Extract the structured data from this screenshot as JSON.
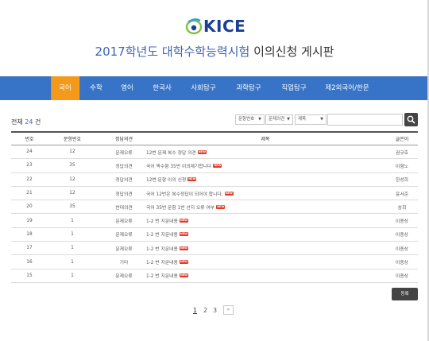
{
  "logo": {
    "text": "KICE"
  },
  "title": {
    "part1": "2017학년도 대학수학능력시험",
    "part2": "이의신청 게시판"
  },
  "nav": {
    "items": [
      {
        "label": "국어",
        "active": true
      },
      {
        "label": "수학",
        "active": false
      },
      {
        "label": "영어",
        "active": false
      },
      {
        "label": "한국사",
        "active": false
      },
      {
        "label": "사회탐구",
        "active": false
      },
      {
        "label": "과학탐구",
        "active": false
      },
      {
        "label": "직업탐구",
        "active": false
      },
      {
        "label": "제2외국어/한문",
        "active": false
      }
    ]
  },
  "count": {
    "prefix": "전체",
    "value": "24",
    "suffix": "건"
  },
  "filters": {
    "type": "문항번호",
    "opinion": "문제의견",
    "field": "제목"
  },
  "table": {
    "headers": {
      "no": "번호",
      "question": "문항번호",
      "opinion": "정답의견",
      "title": "제목",
      "author": "글쓴이"
    },
    "rows": [
      {
        "no": "24",
        "question": "12",
        "opinion": "문제오류",
        "title": "12번 문제 복수 정답 의견",
        "new": "NEW",
        "author": "권규호"
      },
      {
        "no": "23",
        "question": "35",
        "opinion": "정답의견",
        "title": "국어 짝수형 35번 이의제기합니다",
        "new": "NEW",
        "author": "이형노"
      },
      {
        "no": "22",
        "question": "12",
        "opinion": "정답의견",
        "title": "12번 문항 이의 신청",
        "new": "NEW",
        "author": "한성희"
      },
      {
        "no": "21",
        "question": "12",
        "opinion": "정답의견",
        "title": "국어 12번은 복수정답이 되어야 합니다.",
        "new": "NEW",
        "author": "윤서준"
      },
      {
        "no": "20",
        "question": "35",
        "opinion": "반대의견",
        "title": "국어 35번 문항 1번 선지 오류 여부",
        "new": "NEW",
        "author": "송희"
      },
      {
        "no": "19",
        "question": "1",
        "opinion": "문제오류",
        "title": "1-2 번 지문내용",
        "new": "NEW",
        "author": "이종상"
      },
      {
        "no": "18",
        "question": "1",
        "opinion": "문제오류",
        "title": "1-2 번 지문내용",
        "new": "NEW",
        "author": "이종상"
      },
      {
        "no": "17",
        "question": "1",
        "opinion": "문제오류",
        "title": "1-2 번 지문내용",
        "new": "NEW",
        "author": "이종상"
      },
      {
        "no": "16",
        "question": "1",
        "opinion": "기타",
        "title": "1-2 번 지문내용",
        "new": "NEW",
        "author": "이종상"
      },
      {
        "no": "15",
        "question": "1",
        "opinion": "문제오류",
        "title": "1-2 번 지문내용",
        "new": "NEW",
        "author": "이종상"
      }
    ]
  },
  "write_button": "등록",
  "pager": {
    "pages": [
      "1",
      "2",
      "3"
    ],
    "current": "1",
    "next": "»"
  }
}
